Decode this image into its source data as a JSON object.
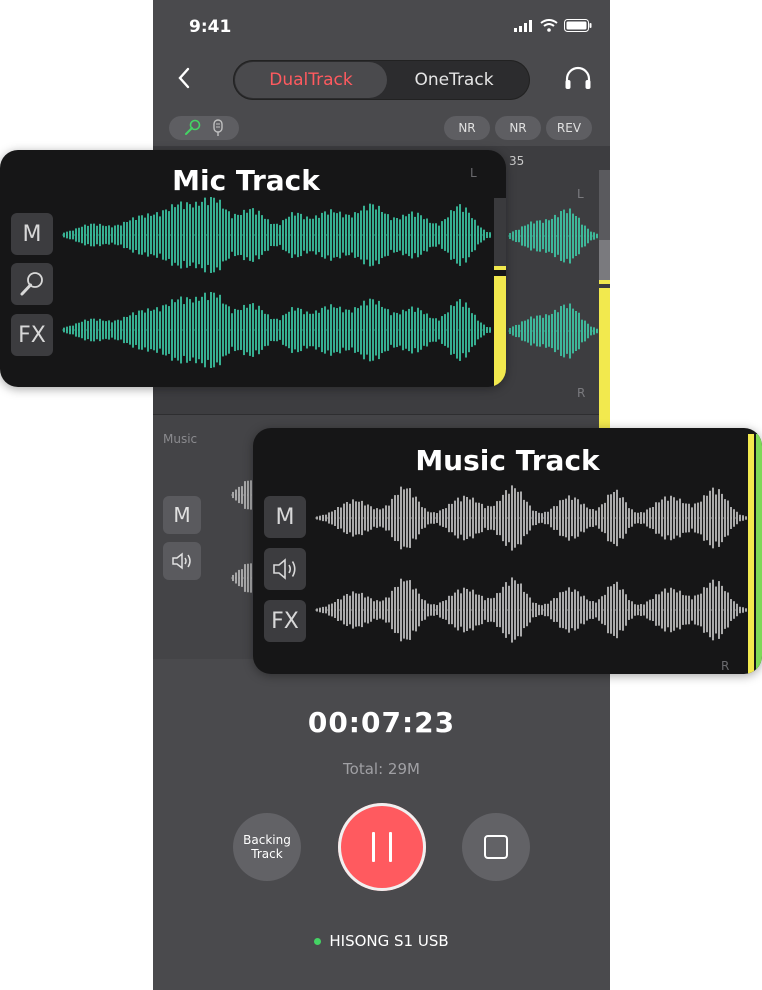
{
  "status": {
    "time": "9:41",
    "icons": [
      "signal-icon",
      "wifi-icon",
      "battery-icon"
    ]
  },
  "nav": {
    "back_icon": "chevron-left-icon",
    "mode_tabs": [
      {
        "label": "DualTrack",
        "active": true
      },
      {
        "label": "OneTrack",
        "active": false
      }
    ],
    "monitor_icon": "headphones-icon"
  },
  "controls": {
    "input_icons": [
      "microphone-icon",
      "usb-mic-icon"
    ],
    "effects": [
      "NR",
      "NR",
      "REV"
    ]
  },
  "phone_tracks": {
    "mic_lane": {
      "tick_label": "35",
      "left": "L",
      "right": "R"
    },
    "music_lane": {
      "label": "Music",
      "mute": "M",
      "speaker_icon": "speaker-icon"
    }
  },
  "mic_card": {
    "title": "Mic Track",
    "buttons": {
      "mute": "M",
      "fx": "FX"
    },
    "mic_icon": "microphone-icon",
    "left": "L"
  },
  "music_card": {
    "title": "Music Track",
    "buttons": {
      "mute": "M",
      "fx": "FX"
    },
    "speaker_icon": "speaker-icon",
    "right": "R"
  },
  "recorder": {
    "elapsed": "00:07:23",
    "total": "Total: 29M",
    "backing_track_label": "Backing Track",
    "pause_icon": "pause-icon",
    "stop_icon": "stop-icon"
  },
  "device": {
    "name": "HISONG S1 USB",
    "status_color": "#44d364"
  },
  "colors": {
    "accent": "#ff5a5f",
    "mic_wave": "#3ed6b0",
    "music_wave": "#d0d0d0",
    "meter_yellow": "#f2e94e",
    "meter_green": "#7ed957"
  }
}
